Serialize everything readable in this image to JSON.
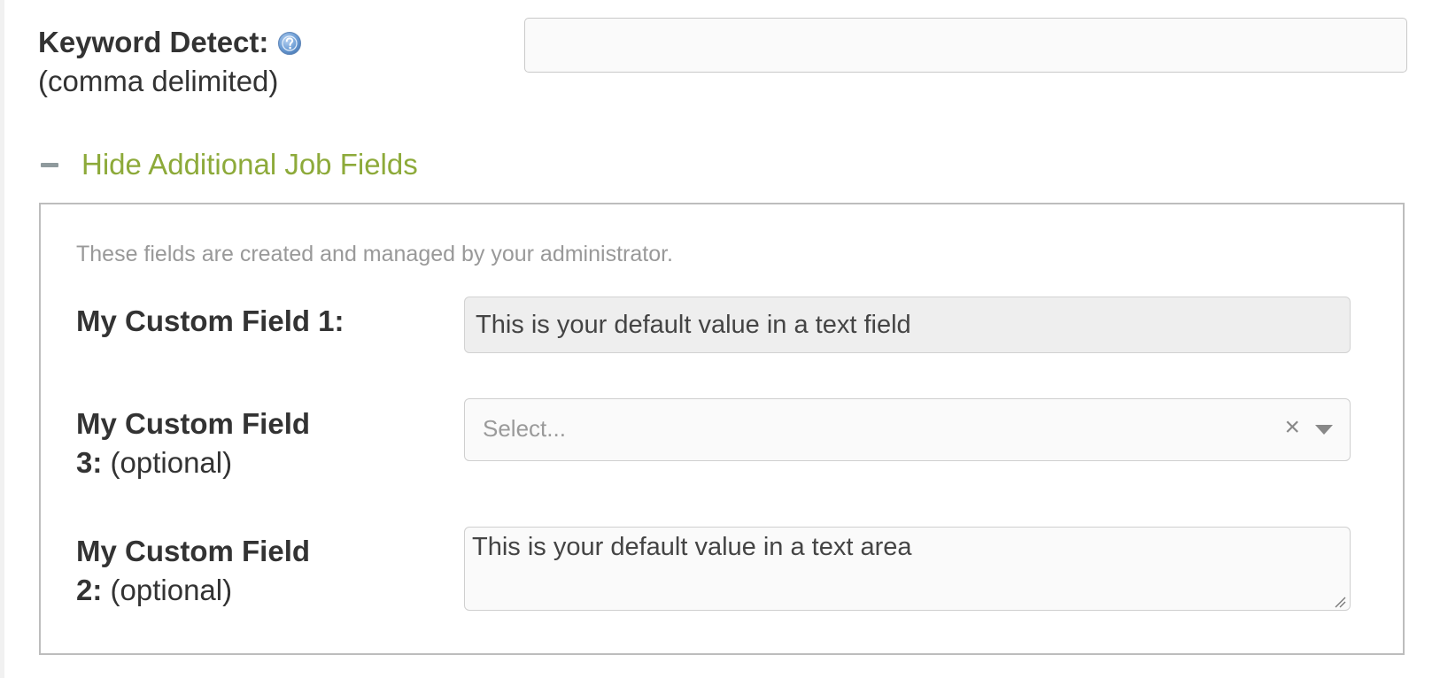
{
  "keyword_detect": {
    "title": "Keyword Detect:",
    "subtitle": "(comma delimited)",
    "value": "",
    "help_icon": "question-help-icon"
  },
  "toggle": {
    "label": "Hide Additional Job Fields",
    "icon": "minus-icon"
  },
  "panel": {
    "note": "These fields are created and managed by your administrator.",
    "field1": {
      "label": "My Custom Field 1:",
      "value": "This is your default value in a text field"
    },
    "field3": {
      "label_bold_1": "My Custom Field",
      "label_bold_2": "3:",
      "optional": "(optional)",
      "placeholder": "Select...",
      "clear_glyph": "×",
      "arrow_icon": "caret-down-icon"
    },
    "field2": {
      "label_bold_1": "My Custom Field",
      "label_bold_2": "2:",
      "optional": "(optional)",
      "value": "This is your default value in a text area"
    }
  },
  "colors": {
    "toggle_text": "#8daa3a",
    "note_text": "#999999",
    "panel_border": "#bdbdbd"
  }
}
